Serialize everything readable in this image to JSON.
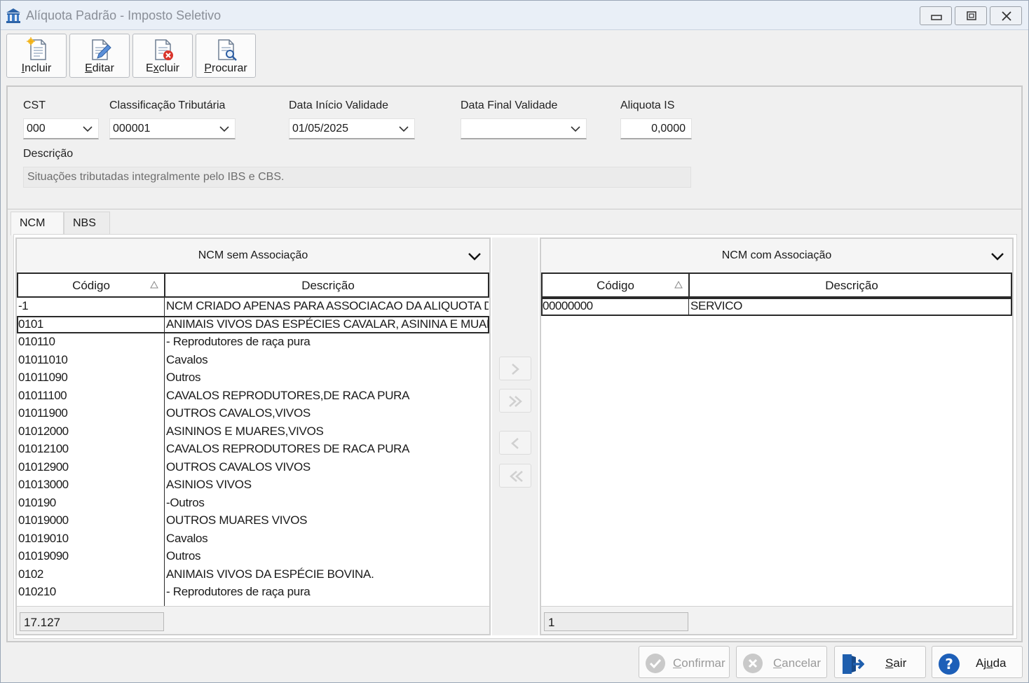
{
  "window": {
    "title": "Alíquota Padrão - Imposto Seletivo"
  },
  "toolbar": {
    "incluir": {
      "first": "I",
      "rest": "ncluir"
    },
    "editar": {
      "first": "E",
      "rest": "ditar"
    },
    "excluir": {
      "first": "E",
      "mid": "x",
      "rest": "cluir"
    },
    "procurar": {
      "first": "P",
      "rest": "rocurar"
    }
  },
  "form": {
    "cst": {
      "label": "CST",
      "value": "000"
    },
    "classificacao": {
      "label": "Classificação Tributária",
      "value": "000001"
    },
    "data_inicio": {
      "label": "Data Início Validade",
      "value": "01/05/2025"
    },
    "data_final": {
      "label": "Data Final Validade",
      "value": ""
    },
    "aliquota": {
      "label": "Aliquota IS",
      "value": "0,0000"
    },
    "descricao": {
      "label": "Descrição",
      "value": "Situações tributadas integralmente pelo IBS e CBS."
    }
  },
  "tabs": [
    {
      "label": "NCM",
      "active": true
    },
    {
      "label": "NBS",
      "active": false
    }
  ],
  "left_grid": {
    "title": "NCM sem Associação",
    "columns": [
      "Código",
      "Descrição"
    ],
    "rows": [
      {
        "codigo": "-1",
        "descricao": "NCM CRIADO APENAS PARA ASSOCIACAO DA ALIQUOTA D"
      },
      {
        "codigo": "0101",
        "descricao": "ANIMAIS VIVOS DAS ESPÉCIES CAVALAR, ASININA E MUAR"
      },
      {
        "codigo": "010110",
        "descricao": "- Reprodutores de raça pura"
      },
      {
        "codigo": "01011010",
        "descricao": "Cavalos"
      },
      {
        "codigo": "01011090",
        "descricao": "Outros"
      },
      {
        "codigo": "01011100",
        "descricao": "CAVALOS REPRODUTORES,DE RACA PURA"
      },
      {
        "codigo": "01011900",
        "descricao": "OUTROS CAVALOS,VIVOS"
      },
      {
        "codigo": "01012000",
        "descricao": "ASININOS E MUARES,VIVOS"
      },
      {
        "codigo": "01012100",
        "descricao": "CAVALOS REPRODUTORES DE RACA PURA"
      },
      {
        "codigo": "01012900",
        "descricao": "OUTROS CAVALOS VIVOS"
      },
      {
        "codigo": "01013000",
        "descricao": "ASINIOS VIVOS"
      },
      {
        "codigo": "010190",
        "descricao": "-Outros"
      },
      {
        "codigo": "01019000",
        "descricao": "OUTROS MUARES VIVOS"
      },
      {
        "codigo": "01019010",
        "descricao": "Cavalos"
      },
      {
        "codigo": "01019090",
        "descricao": "Outros"
      },
      {
        "codigo": "0102",
        "descricao": "ANIMAIS VIVOS DA ESPÉCIE BOVINA."
      },
      {
        "codigo": "010210",
        "descricao": "- Reprodutores de raça pura"
      }
    ],
    "count": "17.127"
  },
  "right_grid": {
    "title": "NCM com Associação",
    "columns": [
      "Código",
      "Descrição"
    ],
    "rows": [
      {
        "codigo": "00000000",
        "descricao": "SERVICO"
      }
    ],
    "count": "1"
  },
  "footer": {
    "confirmar": {
      "first": "C",
      "rest": "onfirmar"
    },
    "cancelar": {
      "first": "C",
      "rest": "ancelar"
    },
    "sair": {
      "first": "S",
      "rest": "air"
    },
    "ajuda": {
      "first": "Aj",
      "mid": "u",
      "rest": "da"
    }
  },
  "colors": {
    "titlebar": "#e9eff7",
    "help_blue": "#1d5fb8",
    "exit_blue": "#1f5fae",
    "delete_red": "#d9342b"
  }
}
